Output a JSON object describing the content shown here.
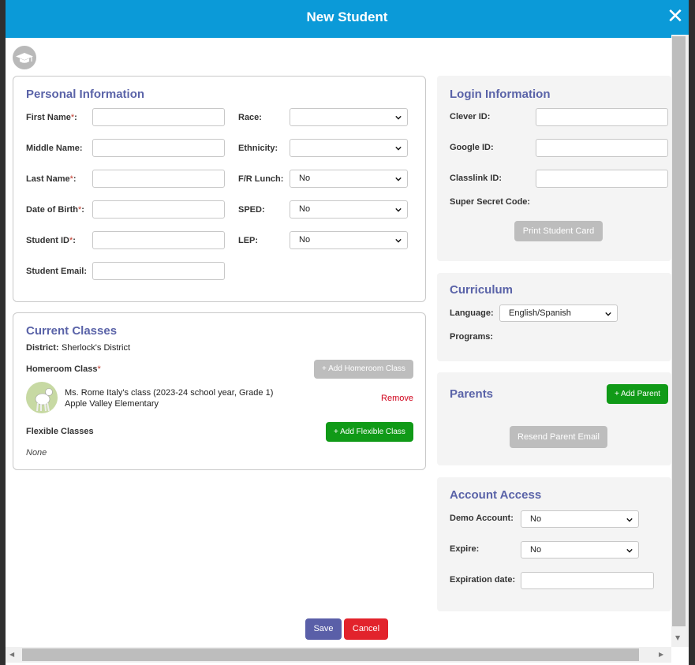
{
  "modal": {
    "title": "New Student",
    "close_glyph": "✕"
  },
  "personal": {
    "title": "Personal Information",
    "first_name_label": "First Name",
    "middle_name_label": "Middle Name:",
    "last_name_label": "Last Name",
    "dob_label": "Date of Birth",
    "student_id_label": "Student ID",
    "email_label": "Student Email:",
    "required_marker": "*",
    "colon": ":",
    "race_label": "Race:",
    "ethnicity_label": "Ethnicity:",
    "frlunch_label": "F/R Lunch:",
    "sped_label": "SPED:",
    "lep_label": "LEP:",
    "race_value": "",
    "ethnicity_value": "",
    "frlunch_value": "No",
    "sped_value": "No",
    "lep_value": "No"
  },
  "classes": {
    "title": "Current Classes",
    "district_label": "District:",
    "district_value": "Sherlock's District",
    "homeroom_label": "Homeroom Class",
    "add_homeroom": "+ Add Homeroom Class",
    "class_name": "Ms. Rome Italy's class (2023-24 school year, Grade 1)",
    "school_name": "Apple Valley Elementary",
    "remove": "Remove",
    "flexible_label": "Flexible Classes",
    "add_flexible": "+ Add Flexible Class",
    "flexible_none": "None"
  },
  "login": {
    "title": "Login Information",
    "clever_label": "Clever ID:",
    "google_label": "Google ID:",
    "classlink_label": "Classlink ID:",
    "secret_label": "Super Secret Code:",
    "print_card": "Print Student Card"
  },
  "curriculum": {
    "title": "Curriculum",
    "language_label": "Language:",
    "language_value": "English/Spanish",
    "programs_label": "Programs:"
  },
  "parents": {
    "title": "Parents",
    "add_parent": "+ Add Parent",
    "resend_email": "Resend Parent Email"
  },
  "account": {
    "title": "Account Access",
    "demo_label": "Demo Account:",
    "demo_value": "No",
    "expire_label": "Expire:",
    "expire_value": "No",
    "expiration_label": "Expiration date:"
  },
  "footer": {
    "save": "Save",
    "cancel": "Cancel"
  },
  "colors": {
    "header": "#0b9ad8",
    "title_text": "#5a63a8",
    "save": "#5a5fa8",
    "cancel": "#e2232c",
    "green": "#109a17",
    "disabled": "#bdbdbd",
    "remove": "#d0021b"
  },
  "icons": [
    "graduation-cap-icon",
    "close-icon",
    "chevron-down-icon",
    "lamb-avatar-icon"
  ]
}
